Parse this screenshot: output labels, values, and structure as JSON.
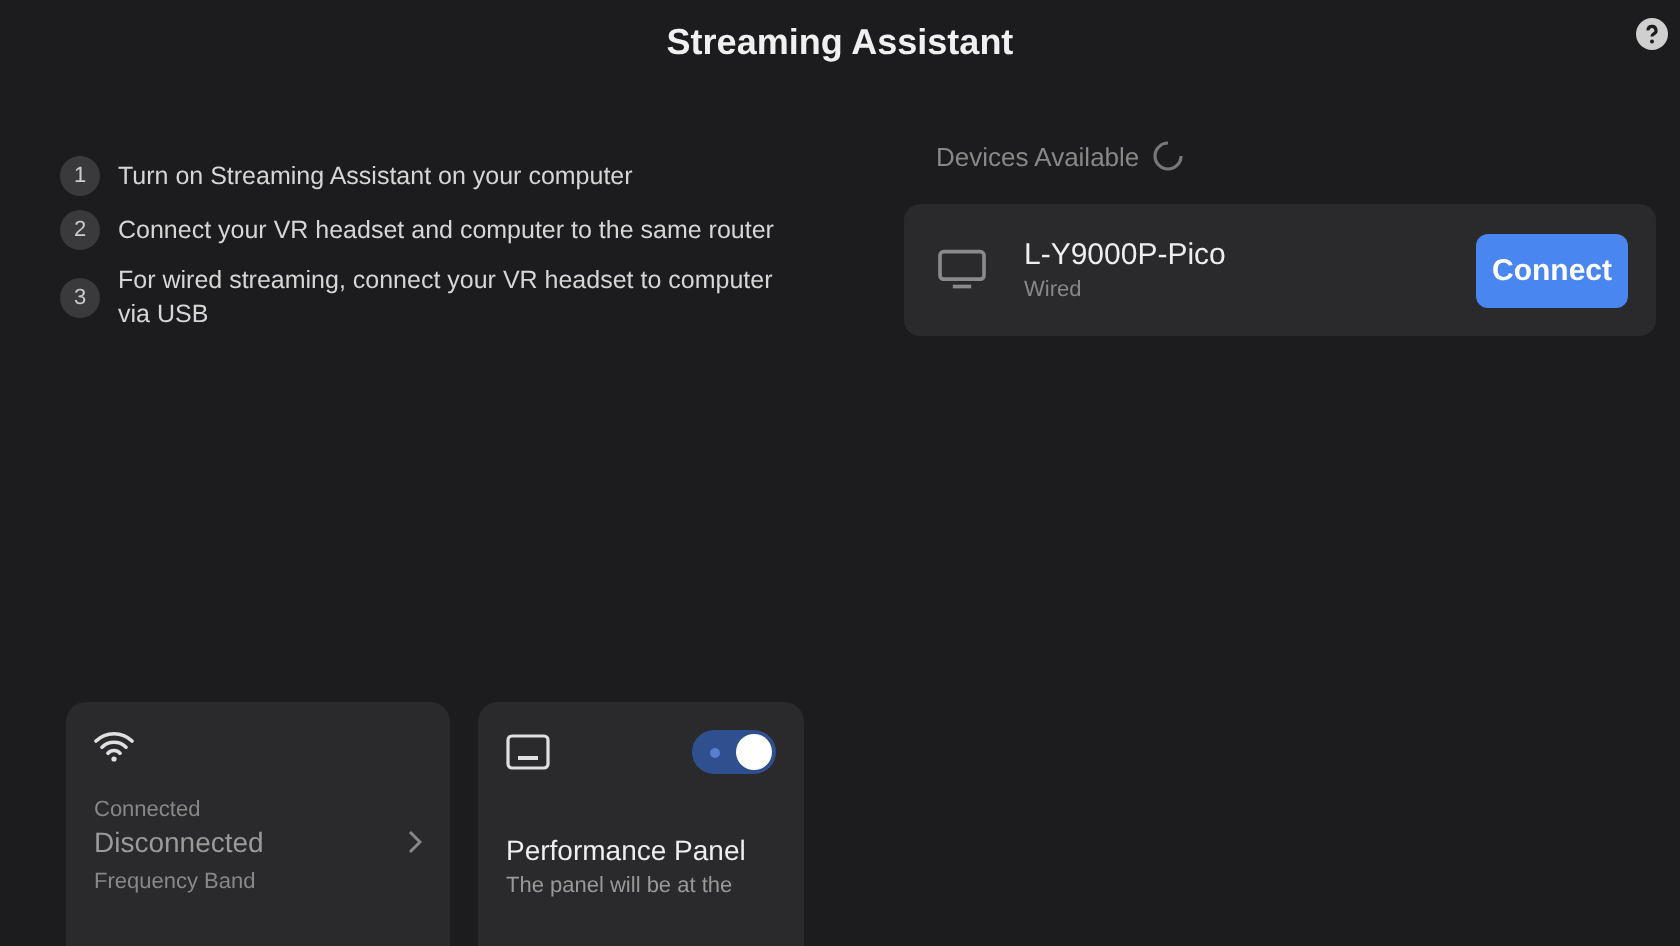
{
  "window": {
    "title": "Streaming Assistant"
  },
  "steps": [
    {
      "number": "1",
      "text": "Turn on Streaming Assistant on your computer"
    },
    {
      "number": "2",
      "text": "Connect your VR headset and computer to the same router"
    },
    {
      "number": "3",
      "text": "For wired streaming, connect your VR headset to computer via USB"
    }
  ],
  "devices": {
    "heading": "Devices Available",
    "searching": true,
    "items": [
      {
        "name": "L-Y9000P-Pico",
        "connection": "Wired",
        "button": "Connect"
      }
    ]
  },
  "wifi_card": {
    "label": "Connected",
    "value": "Disconnected",
    "next_label": "Frequency Band"
  },
  "performance_card": {
    "title": "Performance Panel",
    "description": "The panel will be at the",
    "on": true
  }
}
